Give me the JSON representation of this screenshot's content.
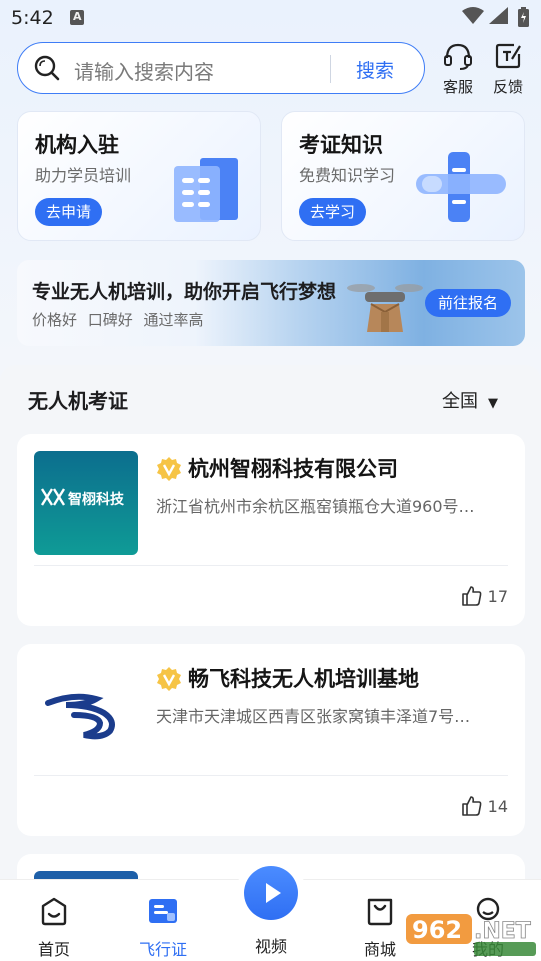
{
  "status_bar": {
    "time": "5:42"
  },
  "search": {
    "placeholder": "请输入搜索内容",
    "button": "搜索"
  },
  "top_actions": [
    {
      "label": "客服",
      "icon": "headset-icon"
    },
    {
      "label": "反馈",
      "icon": "feedback-icon"
    }
  ],
  "cards": [
    {
      "title": "机构入驻",
      "subtitle": "助力学员培训",
      "button": "去申请",
      "icon": "building-icon"
    },
    {
      "title": "考证知识",
      "subtitle": "免费知识学习",
      "button": "去学习",
      "icon": "drone-plane-icon"
    }
  ],
  "banner": {
    "title": "专业无人机培训，助你开启飞行梦想",
    "tags": "价格好  口碑好  通过率高",
    "button": "前往报名"
  },
  "section": {
    "title": "无人机考证",
    "region": "全国"
  },
  "organizations": [
    {
      "name": "杭州智栩科技有限公司",
      "address": "浙江省杭州市余杭区瓶窑镇瓶仓大道960号…",
      "likes": "17",
      "logo_text": "智栩科技",
      "verified": true
    },
    {
      "name": "畅飞科技无人机培训基地",
      "address": "天津市天津城区西青区张家窝镇丰泽道7号…",
      "likes": "14",
      "verified": true
    }
  ],
  "tabs": [
    {
      "label": "首页",
      "icon": "home-icon",
      "active": false
    },
    {
      "label": "飞行证",
      "icon": "license-icon",
      "active": true
    },
    {
      "label": "视频",
      "icon": "play-icon",
      "active": false
    },
    {
      "label": "商城",
      "icon": "shopping-bag-icon",
      "active": false
    },
    {
      "label": "我的",
      "icon": "user-icon",
      "active": false
    }
  ],
  "colors": {
    "accent": "#2f6ff3",
    "logo_teal": "#0e8f95"
  }
}
